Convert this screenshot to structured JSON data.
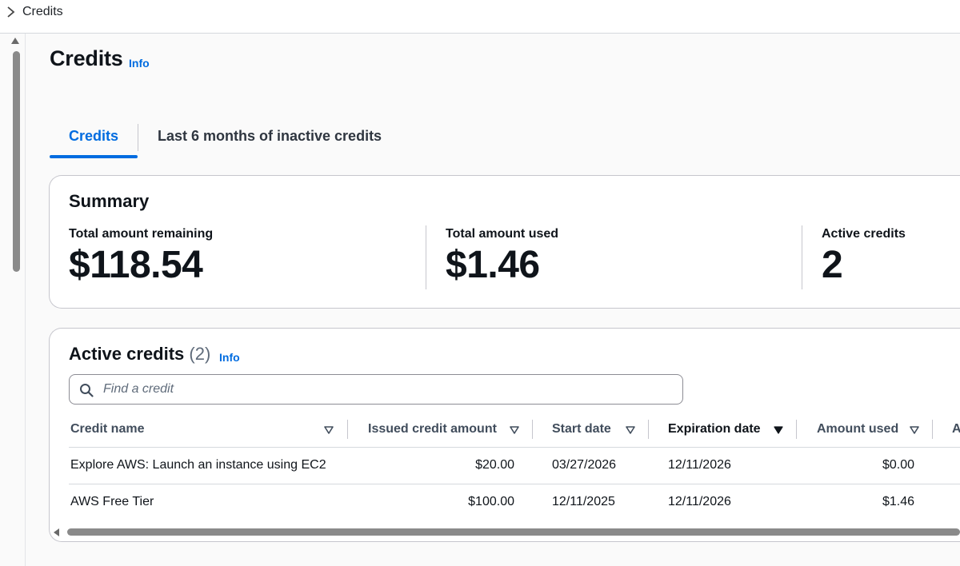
{
  "breadcrumb": {
    "label": "Credits"
  },
  "page": {
    "title": "Credits",
    "info": "Info"
  },
  "tabs": [
    {
      "label": "Credits",
      "active": true
    },
    {
      "label": "Last 6 months of inactive credits",
      "active": false
    }
  ],
  "summary": {
    "title": "Summary",
    "metrics": [
      {
        "label": "Total amount remaining",
        "value": "$118.54"
      },
      {
        "label": "Total amount used",
        "value": "$1.46"
      },
      {
        "label": "Active credits",
        "value": "2"
      }
    ]
  },
  "active_credits": {
    "title": "Active credits",
    "count": "(2)",
    "info": "Info",
    "search_placeholder": "Find a credit",
    "columns": [
      "Credit name",
      "Issued credit amount",
      "Start date",
      "Expiration date",
      "Amount used",
      "A"
    ],
    "sorted_column": "Expiration date",
    "rows": [
      {
        "name": "Explore AWS: Launch an instance using EC2",
        "issued": "$20.00",
        "start": "03/27/2026",
        "expiration": "12/11/2026",
        "used": "$0.00"
      },
      {
        "name": "AWS Free Tier",
        "issued": "$100.00",
        "start": "12/11/2025",
        "expiration": "12/11/2026",
        "used": "$1.46"
      }
    ]
  },
  "colors": {
    "accent": "#006ce0",
    "text": "#0f141a",
    "border": "#c6c6cd"
  }
}
